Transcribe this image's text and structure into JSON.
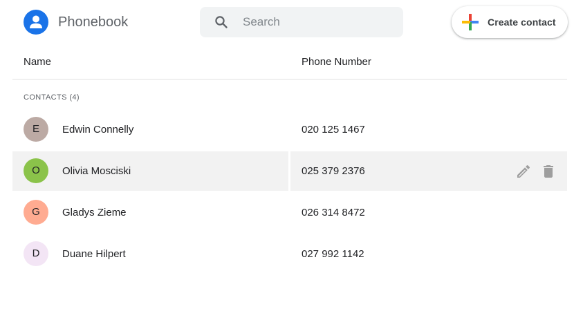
{
  "app": {
    "title": "Phonebook",
    "brand_color": "#1a73e8"
  },
  "search": {
    "placeholder": "Search",
    "value": ""
  },
  "toolbar": {
    "create_label": "Create contact",
    "create_icon": "colorful-plus-icon"
  },
  "table": {
    "headers": {
      "name": "Name",
      "phone": "Phone Number"
    },
    "section_label": "CONTACTS (4)",
    "rows": [
      {
        "initial": "E",
        "name": "Edwin Connelly",
        "phone": "020 125 1467",
        "avatar_color": "#bcaaa4"
      },
      {
        "initial": "O",
        "name": "Olivia Mosciski",
        "phone": "025 379 2376",
        "avatar_color": "#8bc34a",
        "hovered": true
      },
      {
        "initial": "G",
        "name": "Gladys Zieme",
        "phone": "026 314 8472",
        "avatar_color": "#ffab91"
      },
      {
        "initial": "D",
        "name": "Duane Hilpert",
        "phone": "027 992 1142",
        "avatar_color": "#f3e5f5"
      }
    ],
    "row_actions": {
      "edit_icon": "pencil-icon",
      "delete_icon": "trash-icon"
    }
  }
}
